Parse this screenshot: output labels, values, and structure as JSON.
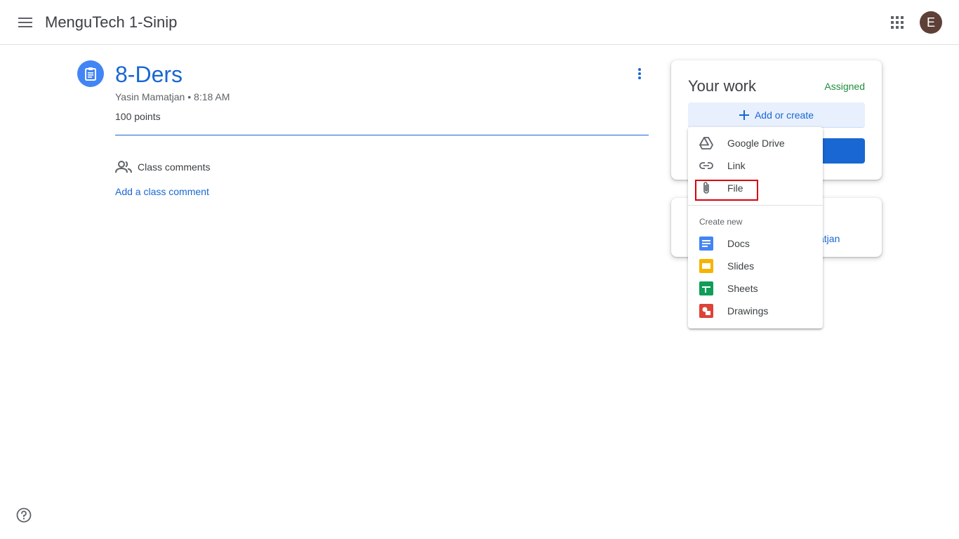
{
  "header": {
    "class_title": "MenguTech 1-Sinip",
    "avatar_letter": "E",
    "icons": {
      "menu": "hamburger-menu-icon",
      "apps": "apps-grid-icon"
    }
  },
  "assignment": {
    "title": "8-Ders",
    "author": "Yasin Mamatjan",
    "separator": "•",
    "time": "8:18 AM",
    "points": "100 points",
    "icon": "assignment-icon",
    "comments_label": "Class comments",
    "add_comment": "Add a class comment"
  },
  "your_work": {
    "title": "Your work",
    "status": "Assigned",
    "add_create": "Add or create",
    "private_partial": "atjan"
  },
  "menu": {
    "items": [
      {
        "label": "Google Drive",
        "icon": "google-drive-icon"
      },
      {
        "label": "Link",
        "icon": "link-icon"
      },
      {
        "label": "File",
        "icon": "paperclip-icon"
      }
    ],
    "section_label": "Create new",
    "create_items": [
      {
        "label": "Docs",
        "icon": "docs-icon",
        "color": "#4285f4"
      },
      {
        "label": "Slides",
        "icon": "slides-icon",
        "color": "#f4b400"
      },
      {
        "label": "Sheets",
        "icon": "sheets-icon",
        "color": "#0f9d58"
      },
      {
        "label": "Drawings",
        "icon": "drawings-icon",
        "color": "#db4437"
      }
    ]
  },
  "colors": {
    "accent_blue": "#1967d2",
    "assigned_green": "#1e8e3e",
    "highlight_red": "#d9000d",
    "avatar_brown": "#5d4037"
  }
}
